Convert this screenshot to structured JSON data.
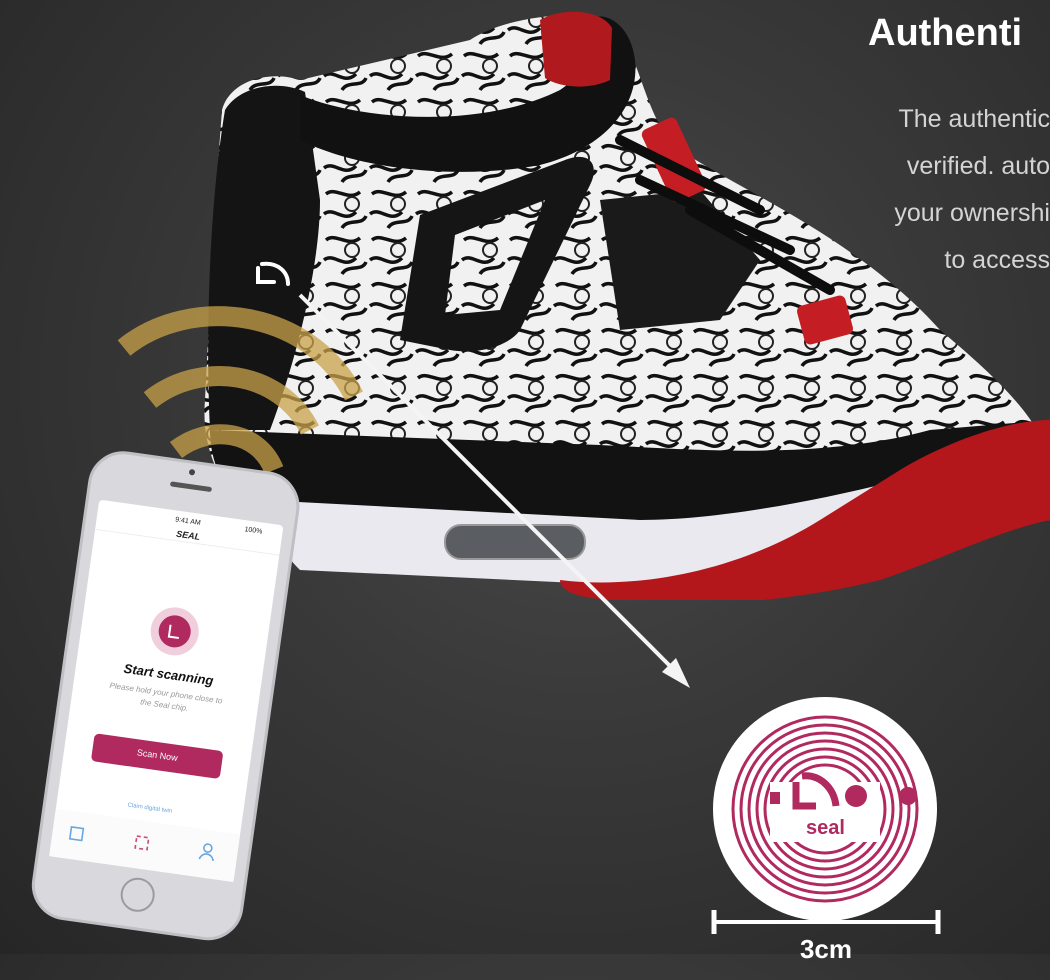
{
  "heading": "Authenti",
  "paragraph_lines": [
    "The authentic",
    "verified. auto",
    "your ownershi",
    "to access"
  ],
  "phone": {
    "status_time": "9:41 AM",
    "status_battery": "100%",
    "app_title": "SEAL",
    "scan_title": "Start scanning",
    "scan_hint_line1": "Please hold your phone close to",
    "scan_hint_line2": "the Seal chip.",
    "scan_button": "Scan Now",
    "claim_link": "Claim digital twin"
  },
  "tag": {
    "brand": "seal"
  },
  "ruler_label": "3cm",
  "colors": {
    "brand_magenta": "#b0295f",
    "nfc_gold": "#c9a24a",
    "background": "#333333"
  }
}
